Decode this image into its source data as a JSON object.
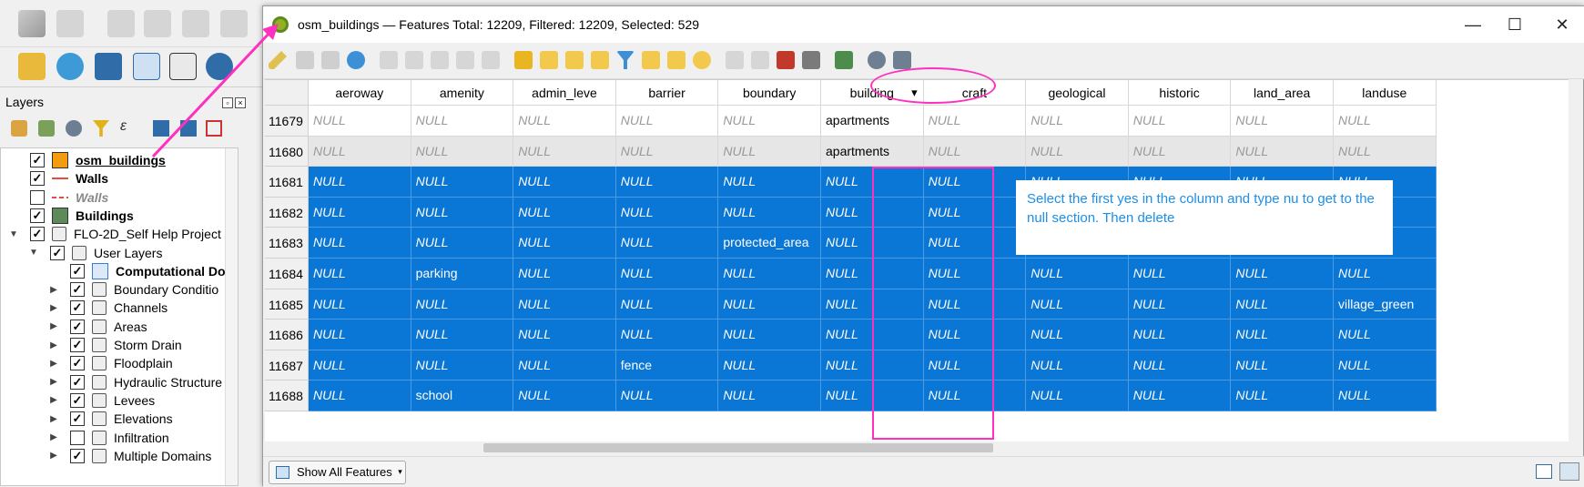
{
  "layers_panel": {
    "title": "Layers",
    "items": [
      {
        "label": "osm_buildings",
        "checked": true,
        "symbol": "orange-fill",
        "style": "bold-underline",
        "indent": 0,
        "expander": ""
      },
      {
        "label": "Walls",
        "checked": true,
        "symbol": "red-line",
        "style": "bold",
        "indent": 0,
        "expander": ""
      },
      {
        "label": "Walls",
        "checked": false,
        "symbol": "red-line-dashed",
        "style": "bold-italic-gray",
        "indent": 0,
        "expander": ""
      },
      {
        "label": "Buildings",
        "checked": true,
        "symbol": "green-fill",
        "style": "bold",
        "indent": 0,
        "expander": ""
      },
      {
        "label": "FLO-2D_Self Help Project",
        "checked": true,
        "symbol": "group",
        "style": "normal",
        "indent": 0,
        "expander": "▼"
      },
      {
        "label": "User Layers",
        "checked": true,
        "symbol": "group",
        "style": "normal",
        "indent": 1,
        "expander": "▼"
      },
      {
        "label": "Computational Do",
        "checked": true,
        "symbol": "blue-outline",
        "style": "bold",
        "indent": 2,
        "expander": ""
      },
      {
        "label": "Boundary Conditio",
        "checked": true,
        "symbol": "group",
        "style": "normal",
        "indent": 2,
        "expander": "▶"
      },
      {
        "label": "Channels",
        "checked": true,
        "symbol": "group",
        "style": "normal",
        "indent": 2,
        "expander": "▶"
      },
      {
        "label": "Areas",
        "checked": true,
        "symbol": "group",
        "style": "normal",
        "indent": 2,
        "expander": "▶"
      },
      {
        "label": "Storm Drain",
        "checked": true,
        "symbol": "group",
        "style": "normal",
        "indent": 2,
        "expander": "▶"
      },
      {
        "label": "Floodplain",
        "checked": true,
        "symbol": "group",
        "style": "normal",
        "indent": 2,
        "expander": "▶"
      },
      {
        "label": "Hydraulic Structure",
        "checked": true,
        "symbol": "group",
        "style": "normal",
        "indent": 2,
        "expander": "▶"
      },
      {
        "label": "Levees",
        "checked": true,
        "symbol": "group",
        "style": "normal",
        "indent": 2,
        "expander": "▶"
      },
      {
        "label": "Elevations",
        "checked": true,
        "symbol": "group",
        "style": "normal",
        "indent": 2,
        "expander": "▶"
      },
      {
        "label": "Infiltration",
        "checked": false,
        "symbol": "group",
        "style": "normal",
        "indent": 2,
        "expander": "▶"
      },
      {
        "label": "Multiple Domains",
        "checked": true,
        "symbol": "group",
        "style": "normal",
        "indent": 2,
        "expander": "▶"
      }
    ]
  },
  "attribute_window": {
    "title": "osm_buildings — Features Total: 12209, Filtered: 12209, Selected: 529",
    "controls": {
      "minimize": "—",
      "maximize": "☐",
      "close": "✕"
    },
    "show_all_label": "Show All Features"
  },
  "table": {
    "columns": [
      "aeroway",
      "amenity",
      "admin_leve",
      "barrier",
      "boundary",
      "building",
      "craft",
      "geological",
      "historic",
      "land_area",
      "landuse"
    ],
    "sorted_column": "building",
    "rows": [
      {
        "id": "11679",
        "selected": false,
        "cells": [
          null,
          null,
          null,
          null,
          null,
          "apartments",
          null,
          null,
          null,
          null,
          null
        ]
      },
      {
        "id": "11680",
        "selected": false,
        "cells": [
          null,
          null,
          null,
          null,
          null,
          "apartments",
          null,
          null,
          null,
          null,
          null
        ]
      },
      {
        "id": "11681",
        "selected": true,
        "cells": [
          null,
          null,
          null,
          null,
          null,
          null,
          null,
          null,
          null,
          null,
          null
        ]
      },
      {
        "id": "11682",
        "selected": true,
        "cells": [
          null,
          null,
          null,
          null,
          null,
          null,
          null,
          null,
          null,
          null,
          null
        ]
      },
      {
        "id": "11683",
        "selected": true,
        "cells": [
          null,
          null,
          null,
          null,
          "protected_area",
          null,
          null,
          null,
          null,
          null,
          null
        ]
      },
      {
        "id": "11684",
        "selected": true,
        "cells": [
          null,
          "parking",
          null,
          null,
          null,
          null,
          null,
          null,
          null,
          null,
          null
        ]
      },
      {
        "id": "11685",
        "selected": true,
        "cells": [
          null,
          null,
          null,
          null,
          null,
          null,
          null,
          null,
          null,
          null,
          "village_green"
        ]
      },
      {
        "id": "11686",
        "selected": true,
        "cells": [
          null,
          null,
          null,
          null,
          null,
          null,
          null,
          null,
          null,
          null,
          null
        ]
      },
      {
        "id": "11687",
        "selected": true,
        "cells": [
          null,
          null,
          null,
          "fence",
          null,
          null,
          null,
          null,
          null,
          null,
          null
        ]
      },
      {
        "id": "11688",
        "selected": true,
        "cells": [
          null,
          "school",
          null,
          null,
          null,
          null,
          null,
          null,
          null,
          null,
          null
        ]
      }
    ],
    "null_text": "NULL"
  },
  "annotation": {
    "callout_text": "Select the first yes in the column and type nu to get to the null section. Then delete",
    "color": "#ff2fc0",
    "text_color": "#1d8fe8"
  },
  "colors": {
    "selection": "#0a76d6"
  }
}
